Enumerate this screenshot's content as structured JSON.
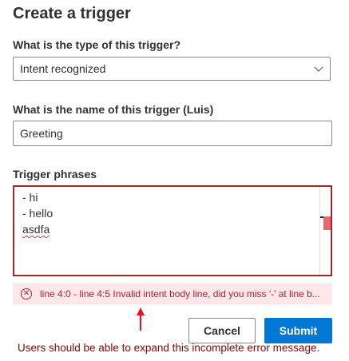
{
  "dialog": {
    "title": "Create a trigger"
  },
  "trigger_type": {
    "label": "What is the type of this trigger?",
    "selected_value": "Intent recognized"
  },
  "trigger_name": {
    "label": "What is the name of this trigger (Luis)",
    "value": "Greeting"
  },
  "trigger_phrases": {
    "label": "Trigger phrases",
    "lines": [
      "- hi",
      "- hello",
      "asdfa"
    ]
  },
  "error": {
    "message": "line 4:0 - line 4:5 Invalid intent body line, did you miss '-' at line b..."
  },
  "buttons": {
    "cancel": "Cancel",
    "submit": "Submit"
  },
  "annotation": {
    "note": "Users should be able to expand this incomplete error message."
  },
  "colors": {
    "error": "#a4262c",
    "error_background": "#fde7e9",
    "primary": "#0078d4",
    "annotation": "#8b0000",
    "arrow": "#e81123"
  },
  "icons": {
    "dropdown": "chevron-down-icon",
    "error": "error-circle-icon",
    "annotation_arrow": "up-arrow-icon"
  }
}
